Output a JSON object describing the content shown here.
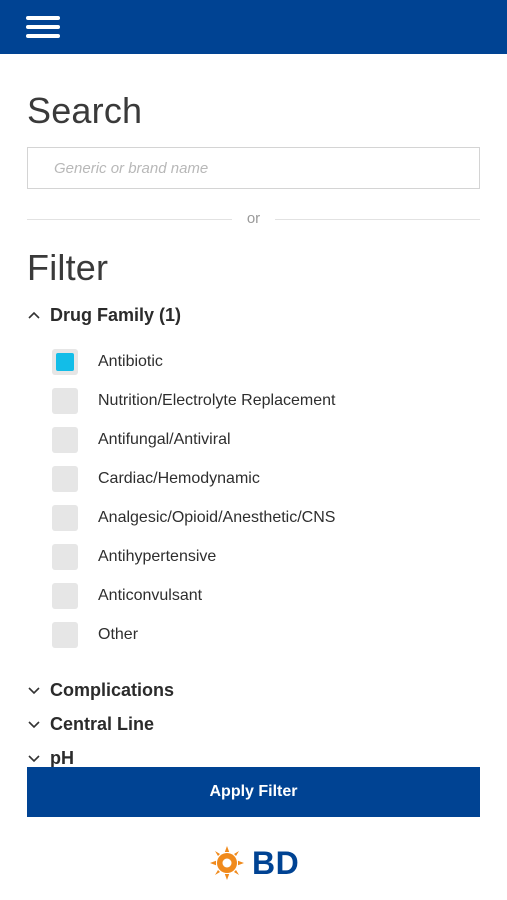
{
  "header": {
    "menu_icon": "hamburger-menu-icon",
    "color": "#004393"
  },
  "search": {
    "title": "Search",
    "placeholder": "Generic or brand name",
    "value": ""
  },
  "divider": {
    "text": "or"
  },
  "filter": {
    "title": "Filter",
    "sections": [
      {
        "label": "Drug Family (1)",
        "expanded": true,
        "options": [
          {
            "label": "Antibiotic",
            "checked": true
          },
          {
            "label": "Nutrition/Electrolyte Replacement",
            "checked": false
          },
          {
            "label": "Antifungal/Antiviral",
            "checked": false
          },
          {
            "label": "Cardiac/Hemodynamic",
            "checked": false
          },
          {
            "label": "Analgesic/Opioid/Anesthetic/CNS",
            "checked": false
          },
          {
            "label": "Antihypertensive",
            "checked": false
          },
          {
            "label": "Anticonvulsant",
            "checked": false
          },
          {
            "label": "Other",
            "checked": false
          }
        ]
      },
      {
        "label": "Complications",
        "expanded": false
      },
      {
        "label": "Central Line",
        "expanded": false
      },
      {
        "label": "pH",
        "expanded": false
      }
    ]
  },
  "apply_button": {
    "label": "Apply Filter"
  },
  "footer": {
    "logo_text": "BD",
    "logo_icon": "bd-sun-logo-icon"
  },
  "colors": {
    "brand_blue": "#004393",
    "check_cyan": "#12bde8",
    "logo_orange": "#f08a1c"
  }
}
